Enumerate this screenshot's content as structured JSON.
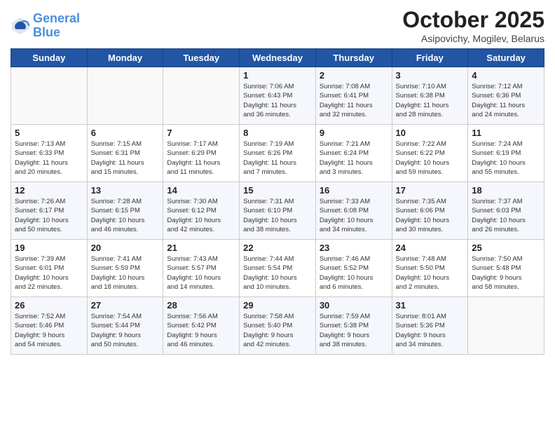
{
  "header": {
    "logo_line1": "General",
    "logo_line2": "Blue",
    "month": "October 2025",
    "location": "Asipovichy, Mogilev, Belarus"
  },
  "weekdays": [
    "Sunday",
    "Monday",
    "Tuesday",
    "Wednesday",
    "Thursday",
    "Friday",
    "Saturday"
  ],
  "weeks": [
    [
      {
        "day": "",
        "detail": ""
      },
      {
        "day": "",
        "detail": ""
      },
      {
        "day": "",
        "detail": ""
      },
      {
        "day": "1",
        "detail": "Sunrise: 7:06 AM\nSunset: 6:43 PM\nDaylight: 11 hours\nand 36 minutes."
      },
      {
        "day": "2",
        "detail": "Sunrise: 7:08 AM\nSunset: 6:41 PM\nDaylight: 11 hours\nand 32 minutes."
      },
      {
        "day": "3",
        "detail": "Sunrise: 7:10 AM\nSunset: 6:38 PM\nDaylight: 11 hours\nand 28 minutes."
      },
      {
        "day": "4",
        "detail": "Sunrise: 7:12 AM\nSunset: 6:36 PM\nDaylight: 11 hours\nand 24 minutes."
      }
    ],
    [
      {
        "day": "5",
        "detail": "Sunrise: 7:13 AM\nSunset: 6:33 PM\nDaylight: 11 hours\nand 20 minutes."
      },
      {
        "day": "6",
        "detail": "Sunrise: 7:15 AM\nSunset: 6:31 PM\nDaylight: 11 hours\nand 15 minutes."
      },
      {
        "day": "7",
        "detail": "Sunrise: 7:17 AM\nSunset: 6:29 PM\nDaylight: 11 hours\nand 11 minutes."
      },
      {
        "day": "8",
        "detail": "Sunrise: 7:19 AM\nSunset: 6:26 PM\nDaylight: 11 hours\nand 7 minutes."
      },
      {
        "day": "9",
        "detail": "Sunrise: 7:21 AM\nSunset: 6:24 PM\nDaylight: 11 hours\nand 3 minutes."
      },
      {
        "day": "10",
        "detail": "Sunrise: 7:22 AM\nSunset: 6:22 PM\nDaylight: 10 hours\nand 59 minutes."
      },
      {
        "day": "11",
        "detail": "Sunrise: 7:24 AM\nSunset: 6:19 PM\nDaylight: 10 hours\nand 55 minutes."
      }
    ],
    [
      {
        "day": "12",
        "detail": "Sunrise: 7:26 AM\nSunset: 6:17 PM\nDaylight: 10 hours\nand 50 minutes."
      },
      {
        "day": "13",
        "detail": "Sunrise: 7:28 AM\nSunset: 6:15 PM\nDaylight: 10 hours\nand 46 minutes."
      },
      {
        "day": "14",
        "detail": "Sunrise: 7:30 AM\nSunset: 6:12 PM\nDaylight: 10 hours\nand 42 minutes."
      },
      {
        "day": "15",
        "detail": "Sunrise: 7:31 AM\nSunset: 6:10 PM\nDaylight: 10 hours\nand 38 minutes."
      },
      {
        "day": "16",
        "detail": "Sunrise: 7:33 AM\nSunset: 6:08 PM\nDaylight: 10 hours\nand 34 minutes."
      },
      {
        "day": "17",
        "detail": "Sunrise: 7:35 AM\nSunset: 6:06 PM\nDaylight: 10 hours\nand 30 minutes."
      },
      {
        "day": "18",
        "detail": "Sunrise: 7:37 AM\nSunset: 6:03 PM\nDaylight: 10 hours\nand 26 minutes."
      }
    ],
    [
      {
        "day": "19",
        "detail": "Sunrise: 7:39 AM\nSunset: 6:01 PM\nDaylight: 10 hours\nand 22 minutes."
      },
      {
        "day": "20",
        "detail": "Sunrise: 7:41 AM\nSunset: 5:59 PM\nDaylight: 10 hours\nand 18 minutes."
      },
      {
        "day": "21",
        "detail": "Sunrise: 7:43 AM\nSunset: 5:57 PM\nDaylight: 10 hours\nand 14 minutes."
      },
      {
        "day": "22",
        "detail": "Sunrise: 7:44 AM\nSunset: 5:54 PM\nDaylight: 10 hours\nand 10 minutes."
      },
      {
        "day": "23",
        "detail": "Sunrise: 7:46 AM\nSunset: 5:52 PM\nDaylight: 10 hours\nand 6 minutes."
      },
      {
        "day": "24",
        "detail": "Sunrise: 7:48 AM\nSunset: 5:50 PM\nDaylight: 10 hours\nand 2 minutes."
      },
      {
        "day": "25",
        "detail": "Sunrise: 7:50 AM\nSunset: 5:48 PM\nDaylight: 9 hours\nand 58 minutes."
      }
    ],
    [
      {
        "day": "26",
        "detail": "Sunrise: 7:52 AM\nSunset: 5:46 PM\nDaylight: 9 hours\nand 54 minutes."
      },
      {
        "day": "27",
        "detail": "Sunrise: 7:54 AM\nSunset: 5:44 PM\nDaylight: 9 hours\nand 50 minutes."
      },
      {
        "day": "28",
        "detail": "Sunrise: 7:56 AM\nSunset: 5:42 PM\nDaylight: 9 hours\nand 46 minutes."
      },
      {
        "day": "29",
        "detail": "Sunrise: 7:58 AM\nSunset: 5:40 PM\nDaylight: 9 hours\nand 42 minutes."
      },
      {
        "day": "30",
        "detail": "Sunrise: 7:59 AM\nSunset: 5:38 PM\nDaylight: 9 hours\nand 38 minutes."
      },
      {
        "day": "31",
        "detail": "Sunrise: 8:01 AM\nSunset: 5:36 PM\nDaylight: 9 hours\nand 34 minutes."
      },
      {
        "day": "",
        "detail": ""
      }
    ]
  ]
}
